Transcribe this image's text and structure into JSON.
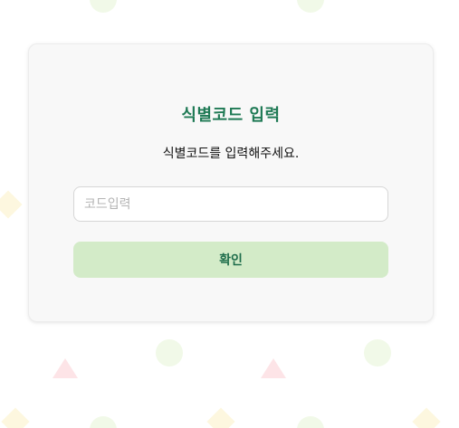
{
  "card": {
    "title": "식별코드 입력",
    "subtitle": "식별코드를 입력해주세요.",
    "input": {
      "placeholder": "코드입력",
      "value": ""
    },
    "confirm_label": "확인"
  },
  "colors": {
    "title": "#1f7a55",
    "button_bg": "#d3ebc8",
    "button_text": "#1f6e4c",
    "card_bg": "#f8f8f8",
    "deco_circle": "#f1f9e8",
    "deco_diamond": "#fdf7df",
    "deco_triangle": "#fde4e7"
  }
}
